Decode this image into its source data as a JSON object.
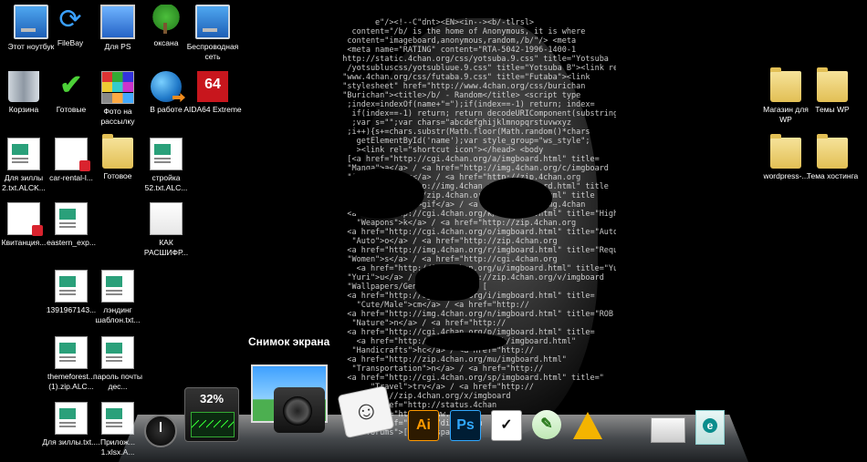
{
  "desktop": {
    "icons": [
      {
        "label": "Этот ноутбук",
        "icon": "computer-icon"
      },
      {
        "label": "FileBay",
        "icon": "filebay-icon"
      },
      {
        "label": "Для PS",
        "icon": "program-icon"
      },
      {
        "label": "оксана",
        "icon": "tree-icon"
      },
      {
        "label": "Беспроводная сеть",
        "icon": "network-icon"
      },
      {
        "label": "Корзина",
        "icon": "recycle-bin-icon"
      },
      {
        "label": "Готовые",
        "icon": "checkmark-icon"
      },
      {
        "label": "Фото на рассылку",
        "icon": "photos-icon"
      },
      {
        "label": "В работе",
        "icon": "globe-icon"
      },
      {
        "label": "AIDA64 Extreme",
        "icon": "aida64-icon"
      },
      {
        "label": "Для зиллы 2.txt.ALCK...",
        "icon": "document-icon"
      },
      {
        "label": "car-rental-l...",
        "icon": "pdf-icon"
      },
      {
        "label": "Готовое",
        "icon": "folder-icon"
      },
      {
        "label": "стройка 52.txt.ALC...",
        "icon": "document-icon"
      },
      {
        "label": "Квитанция...",
        "icon": "pdf-icon"
      },
      {
        "label": "eastern_exp...",
        "icon": "document-icon"
      },
      {
        "label": "КАК РАСШИФР...",
        "icon": "blank-file-icon"
      },
      {
        "label": "1391967143...",
        "icon": "document-icon"
      },
      {
        "label": "лэндинг шаблон.txt...",
        "icon": "document-icon"
      },
      {
        "label": "themeforest... (1).zip.ALC...",
        "icon": "document-icon"
      },
      {
        "label": "пароль почты дес...",
        "icon": "document-icon"
      },
      {
        "label": "Для зиллы.txt....",
        "icon": "document-icon"
      },
      {
        "label": "Прилож... 1.xlsx.A...",
        "icon": "document-icon"
      },
      {
        "label": "Магазин для WP",
        "icon": "folder-icon"
      },
      {
        "label": "Темы WP",
        "icon": "folder-icon"
      },
      {
        "label": "wordpress-...",
        "icon": "folder-icon"
      },
      {
        "label": "Тема хостинга",
        "icon": "document-icon"
      }
    ]
  },
  "dock": {
    "hover_label": "Снимок экрана",
    "cpu_percent": "32%",
    "items": [
      {
        "name": "clock",
        "icon": "clock-icon"
      },
      {
        "name": "cpu-meter",
        "icon": "cpu-meter-icon"
      },
      {
        "name": "screenshot",
        "icon": "camera-icon"
      },
      {
        "name": "sketchbook",
        "icon": "sketch-icon"
      },
      {
        "name": "illustrator",
        "text": "Ai",
        "icon": "illustrator-icon"
      },
      {
        "name": "photoshop",
        "text": "Ps",
        "icon": "photoshop-icon"
      },
      {
        "name": "checklist",
        "text": "✓",
        "icon": "check-app-icon"
      },
      {
        "name": "inkscape",
        "text": "✎",
        "icon": "inkscape-icon"
      },
      {
        "name": "google-drive",
        "icon": "drive-icon"
      },
      {
        "name": "window",
        "icon": "window-icon"
      },
      {
        "name": "eset",
        "icon": "eset-icon"
      }
    ]
  },
  "wallpaper": {
    "code_lines": [
      "         e\"/><!--C\"dnt><EN><in--><b/-tlrsl>",
      "    content=\"/b/ is the home of Anonymous, it is where",
      "   content=\"imageboard,anonymous,random,/b/\"/> <meta",
      "   <meta name=\"RATING\" content=\"RTA-5042-1996-1400-1",
      "  http://static.4chan.org/css/yotsuba.9.css\" title=\"Yotsuba",
      "   /yotsubluscss/yotsubluue.9.css\" title=\"Yotsuba B\"><link rel",
      "  \"www.4chan.org/css/futaba.9.css\" title=\"Futaba\"><link",
      "  \"stylesheet\" href=\"http://www.4chan.org/css/burichan",
      "  \"Burichan\"><title>/b/ - Random</title> <script type",
      "   ;index=indexOf(name+\"=\");if(index==-1) return; index=",
      "    if(index==-1) return; return decodeURIComponent(substring",
      "    ;var s=\"\";var chars=\"abcdefghijklmnopqrstuvwxyz",
      "   ;i++){s+=chars.substr(Math.floor(Math.random()*chars",
      "     getElementById('name');var style_group=\"ws_style\";",
      "     ><link rel=\"shortcut icon\"></head> <body",
      "   [<a href=\"http://cgi.4chan.org/a/imgboard.html\" title=",
      "   \"Manga\">a</a> / <a href=\"http://img.4chan.org/c/imgboard",
      "   \"Anime/Cute\">c</a> / <a href=\"http://zip.4chan.org",
      "       <a href=\"http://img.4chan.org/e/imgboard.html\" title",
      "   [<a href=\"http://zip.4chan.org/g/imgboard.html\" title",
      "    \"Animated GIF\">gif</a> / <a href=\"http://img.4chan",
      "   <a href=\"http://cgi.4chan.org/k/imgboard.html\" title=\"High Re",
      "     \"Weapons\">k</a> / <a href=\"http://zip.4chan.org",
      "   <a href=\"http://cgi.4chan.org/o/imgboard.html\" title=\"Auto",
      "    \"Auto\">o</a> / <a href=\"http://zip.4chan.org",
      "   <a href=\"http://img.4chan.org/r/imgboard.html\" title=\"Request",
      "   \"Women\">s</a> / <a href=\"http://cgi.4chan.org",
      "     <a href=\"http://img.4chan.org/u/imgboard.html\" title=\"Yuri",
      "   \"Yuri\">u</a> / <a href=\"http://zip.4chan.org/v/imgboard",
      "   \"Wallpapers/General\">wg</a>] [",
      "   <a href=\"http://cgi.4chan.org/i/imgboard.html\" title=",
      "     \"Cute/Male\">cm</a> / <a href=\"http://",
      "   <a href=\"http://img.4chan.org/n/imgboard.html\" title=\"ROB",
      "    \"Nature\">n</a> / <a href=\"http://",
      "   <a href=\"http://cgi.4chan.org/p/imgboard.html\" title=",
      "     <a href=\"http://img.4chan.org/ck/imgboard.html\"",
      "    \"Handicrafts\">hc</a> / <a href=\"http://",
      "   <a href=\"http://zip.4chan.org/mu/imgboard.html\"",
      "    \"Transportation\">n</a> / <a href=\"http://",
      "   <a href=\"http://cgi.4chan.org/sp/imgboard.html\" title=\"",
      "        \"Travel\">trv</a> / <a href=\"http://",
      "      \"http://zip.4chan.org/x/imgboard",
      "       <a href=\"http://status.4chan",
      "     <a href=\"http://www.4chan",
      "       <a href=\"http://dis.4chan",
      "       forums\">[</a></span>",
      "     <span class=\"postblock\">"
    ]
  }
}
